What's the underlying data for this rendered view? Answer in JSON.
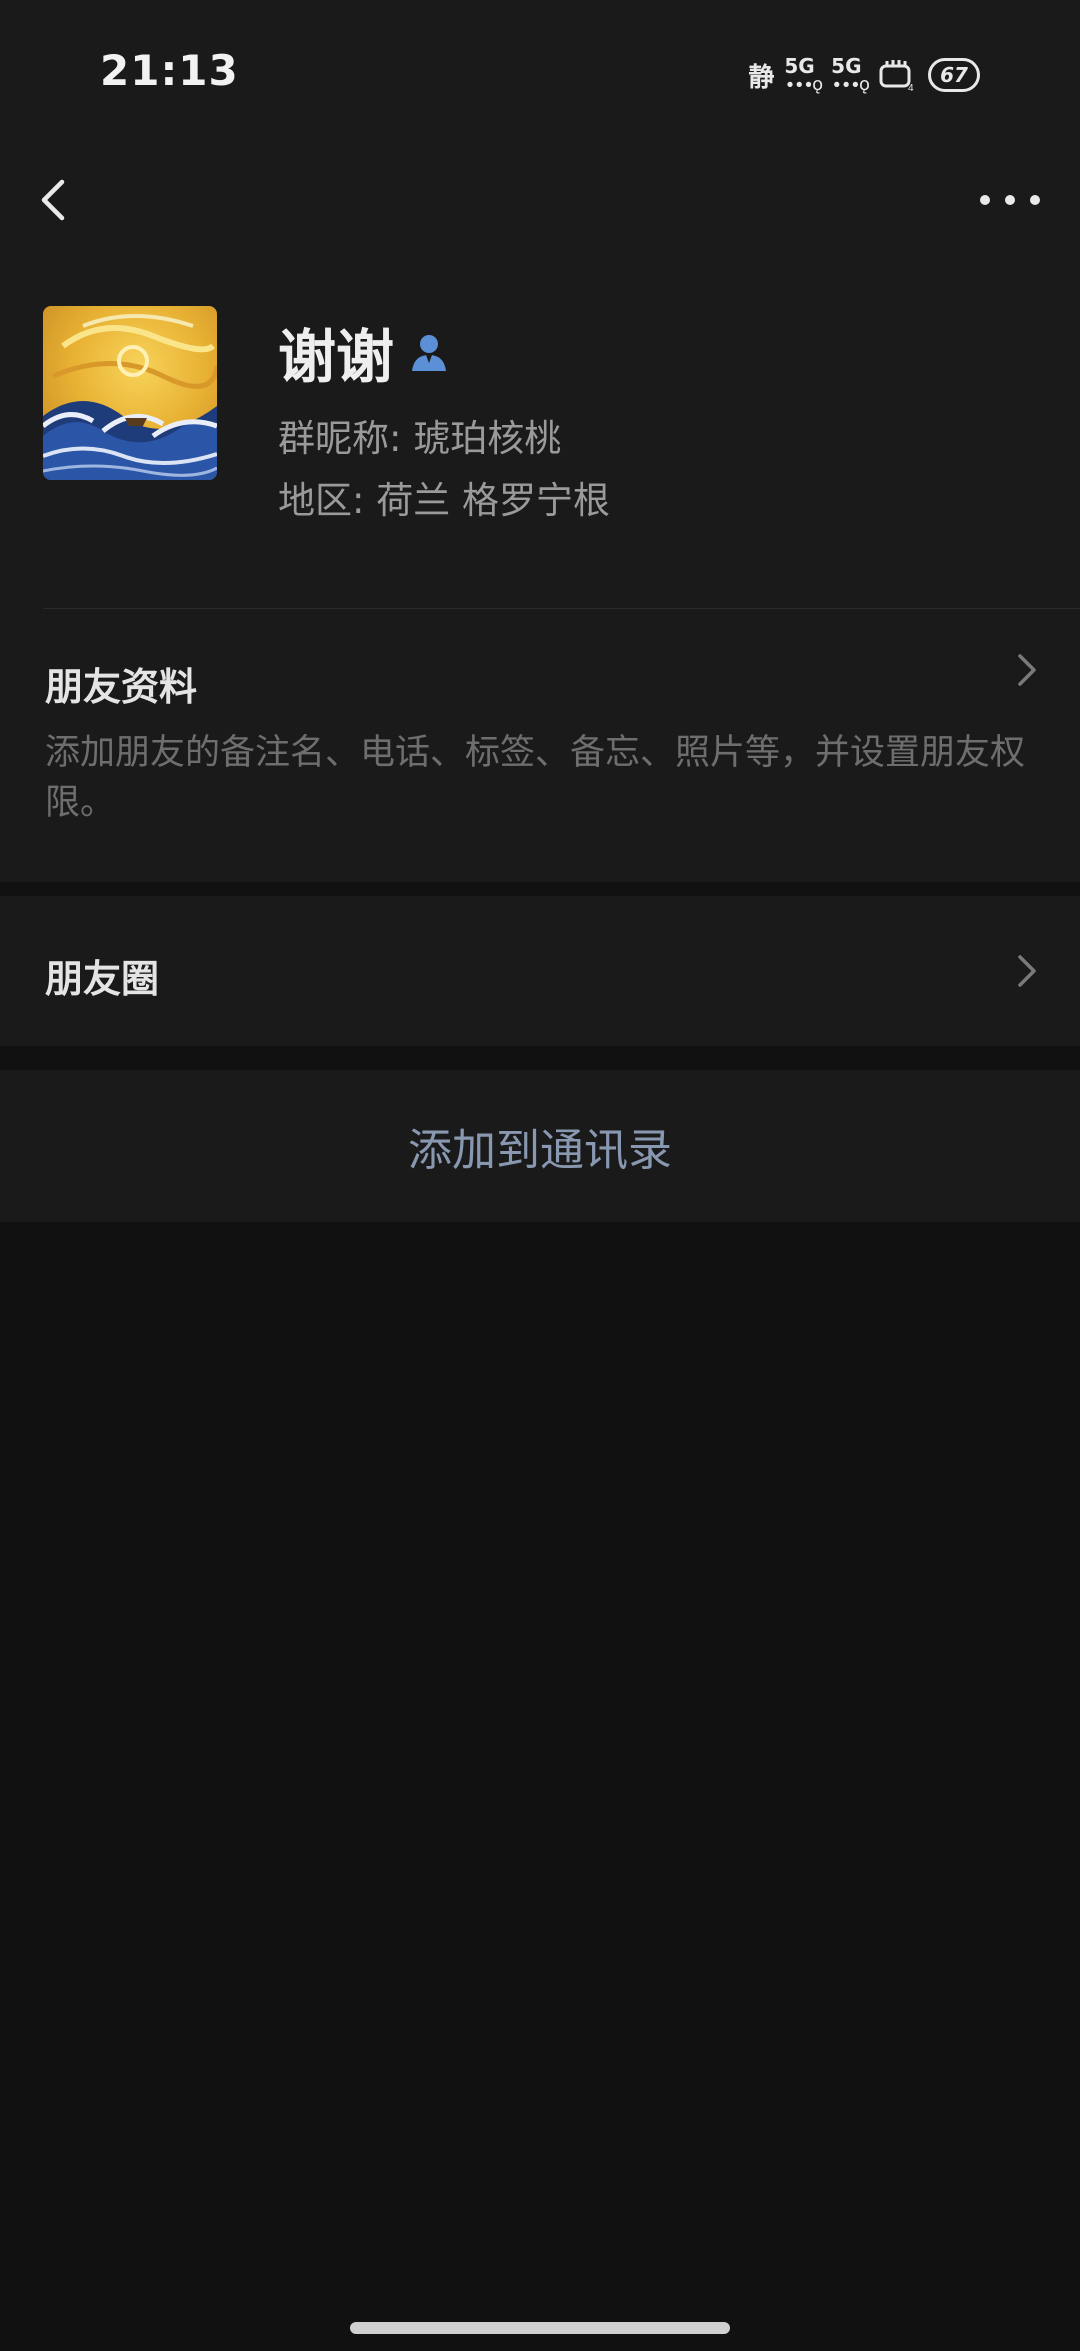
{
  "status_bar": {
    "time": "21:13",
    "silent_label": "静",
    "net1": "5G",
    "net2": "5G",
    "battery": "67"
  },
  "header": {
    "back_icon": "chevron-left-icon",
    "more_icon": "more-dots-icon"
  },
  "profile": {
    "name": "谢谢",
    "nickname": "群昵称:  琥珀核桃",
    "region": "地区:  荷兰  格罗宁根",
    "verified_icon": "person-icon"
  },
  "friend_info": {
    "title": "朋友资料",
    "description": "添加朋友的备注名、电话、标签、备忘、照片等，并设置朋友权限。"
  },
  "moments": {
    "title": "朋友圈"
  },
  "actions": {
    "add_to_contacts": "添加到通讯录"
  },
  "colors": {
    "background": "#111111",
    "card": "#1a1a1a",
    "accent_link": "#8898b0",
    "verified": "#5b8fd6"
  }
}
